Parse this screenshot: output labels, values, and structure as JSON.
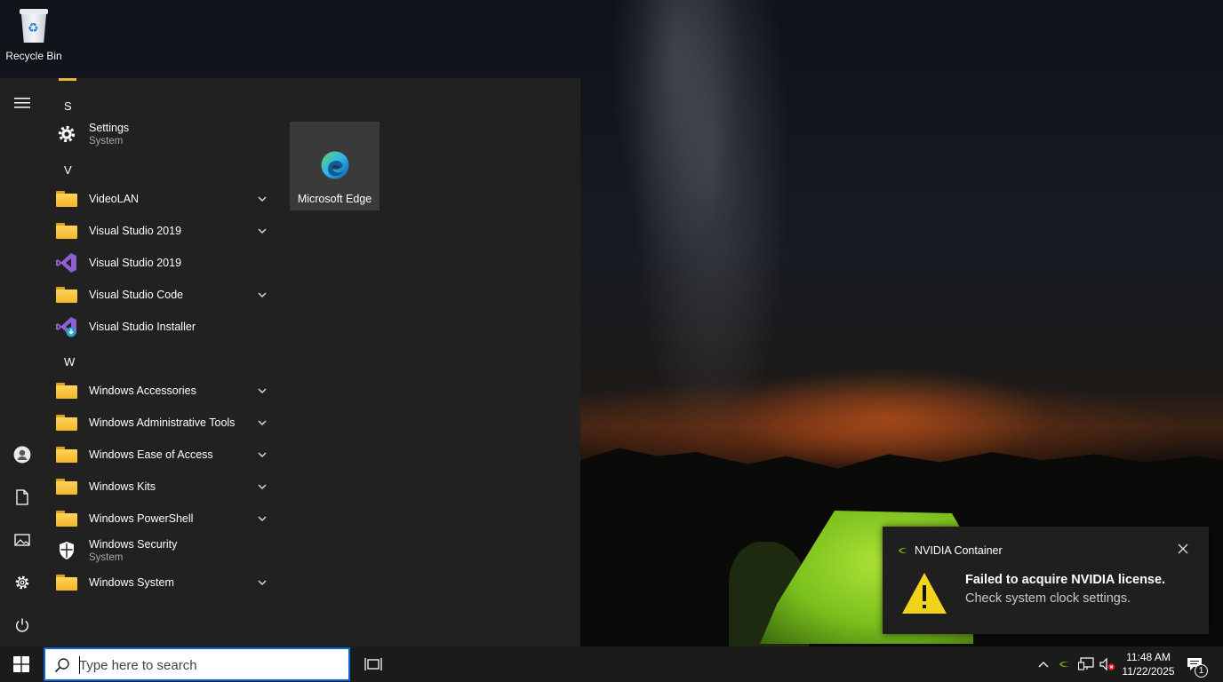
{
  "desktop": {
    "icons": [
      {
        "label": "Recycle Bin",
        "icon": "recycle-bin-icon"
      }
    ]
  },
  "start_menu": {
    "rail": [
      {
        "name": "menu",
        "icon": "hamburger-icon"
      },
      {
        "name": "user",
        "icon": "user-icon"
      },
      {
        "name": "documents",
        "icon": "document-icon"
      },
      {
        "name": "pictures",
        "icon": "pictures-icon"
      },
      {
        "name": "settings",
        "icon": "gear-icon"
      },
      {
        "name": "power",
        "icon": "power-icon"
      }
    ],
    "letters": {
      "s": "S",
      "v": "V",
      "w": "W"
    },
    "apps": [
      {
        "name": "Settings",
        "sub": "System",
        "icon": "gear-icon"
      },
      {
        "name": "VideoLAN",
        "icon": "folder-icon",
        "expandable": true
      },
      {
        "name": "Visual Studio 2019",
        "icon": "folder-icon",
        "expandable": true
      },
      {
        "name": "Visual Studio 2019",
        "icon": "visual-studio-icon"
      },
      {
        "name": "Visual Studio Code",
        "icon": "folder-icon",
        "expandable": true
      },
      {
        "name": "Visual Studio Installer",
        "icon": "visual-studio-installer-icon"
      },
      {
        "name": "Windows Accessories",
        "icon": "folder-icon",
        "expandable": true
      },
      {
        "name": "Windows Administrative Tools",
        "icon": "folder-icon",
        "expandable": true
      },
      {
        "name": "Windows Ease of Access",
        "icon": "folder-icon",
        "expandable": true
      },
      {
        "name": "Windows Kits",
        "icon": "folder-icon",
        "expandable": true
      },
      {
        "name": "Windows PowerShell",
        "icon": "folder-icon",
        "expandable": true
      },
      {
        "name": "Windows Security",
        "sub": "System",
        "icon": "shield-icon"
      },
      {
        "name": "Windows System",
        "icon": "folder-icon",
        "expandable": true
      }
    ],
    "tiles": [
      {
        "label": "Microsoft Edge",
        "icon": "edge-icon"
      }
    ]
  },
  "toast": {
    "app": "NVIDIA Container",
    "title": "Failed to acquire NVIDIA license.",
    "body": "Check system clock settings."
  },
  "taskbar": {
    "search_placeholder": "Type here to search",
    "time": "11:48 AM",
    "date": "11/22/2025",
    "notification_count": "1"
  },
  "colors": {
    "accent": "#0a64d8",
    "folder": "#f4b62a",
    "warning": "#f2d31b",
    "nvidia": "#76b900",
    "vs_purple": "#8e5fd0"
  }
}
